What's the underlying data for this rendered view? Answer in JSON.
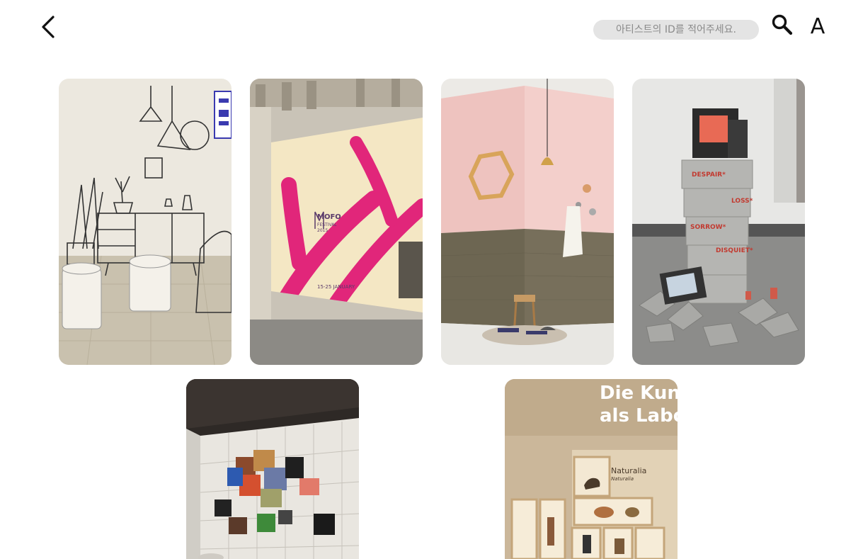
{
  "header": {
    "back_icon": "chevron-left-icon",
    "search_placeholder": "아티스트의 ID를 적어주세요.",
    "search_icon": "search-icon",
    "profile_letter": "A"
  },
  "gallery": {
    "items": [
      {
        "subject": "cartoon-sketch-living-room-installation"
      },
      {
        "subject": "mofo-festival-building-wrap-poster",
        "texts": {
          "brand": "MOFO",
          "sub": "FESTIVAL",
          "year": "2015",
          "date": "15-25 JANUARY"
        }
      },
      {
        "subject": "pink-and-olive-interior-corner"
      },
      {
        "subject": "tv-and-cinder-block-installation",
        "texts": {
          "w1": "DESPAIR*",
          "w2": "LOSS*",
          "w3": "SORROW*",
          "w4": "DISQUIET*"
        }
      },
      {
        "subject": "jigsaw-puzzle-wall-installation"
      },
      {
        "subject": "museum-naturalia-display",
        "texts": {
          "head1": "Die Kun",
          "head2": "als Labo",
          "label": "Naturalia",
          "label_sub": "Naturalia"
        }
      }
    ]
  }
}
